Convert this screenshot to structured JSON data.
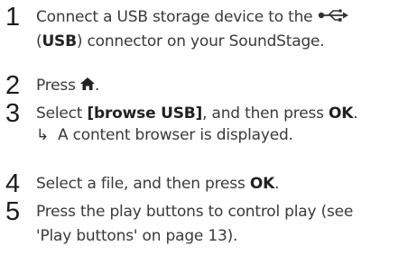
{
  "steps": [
    {
      "number": "1",
      "line1_text": "Connect a USB storage device to the",
      "line2_prefix": "(",
      "line2_bold": "USB",
      "line2_suffix": ") connector on your SoundStage.",
      "icon": "usb-icon"
    },
    {
      "number": "2",
      "text": "Press",
      "icon": "home-icon",
      "after_icon": "."
    },
    {
      "number": "3",
      "text_a": "Select ",
      "bold_a": "[browse USB]",
      "text_b": ", and then press ",
      "bold_b": "OK",
      "text_c": ".",
      "result_arrow": "↳",
      "result_text": "A content browser is displayed."
    },
    {
      "number": "4",
      "text_a": "Select a file, and then press ",
      "bold_a": "OK",
      "text_b": "."
    },
    {
      "number": "5",
      "line1": "Press the play buttons to control play (see",
      "line2": "'Play buttons' on page 13)."
    }
  ]
}
